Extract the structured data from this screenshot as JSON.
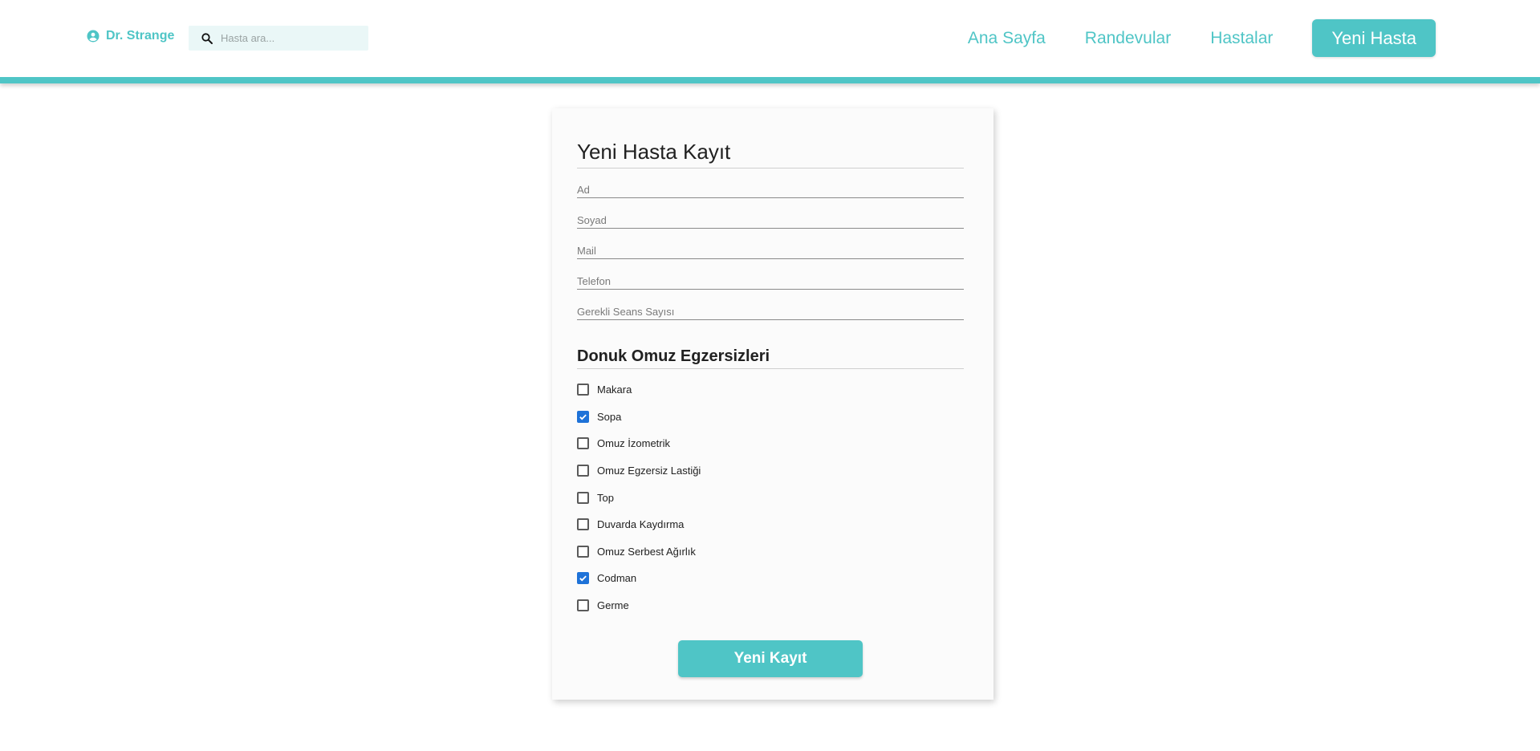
{
  "colors": {
    "accent": "#4fc5c6",
    "checkbox_checked": "#1e72d8",
    "search_bg": "#eaf7f7"
  },
  "header": {
    "user_name": "Dr. Strange",
    "user_icon": "account-circle-icon",
    "search_icon": "search-icon",
    "search_placeholder": "Hasta ara...",
    "search_value": "",
    "nav": {
      "home": "Ana Sayfa",
      "appointments": "Randevular",
      "patients": "Hastalar",
      "new_patient": "Yeni Hasta"
    }
  },
  "form": {
    "title": "Yeni Hasta Kayıt",
    "fields": {
      "first_name": {
        "placeholder": "Ad",
        "value": ""
      },
      "last_name": {
        "placeholder": "Soyad",
        "value": ""
      },
      "mail": {
        "placeholder": "Mail",
        "value": ""
      },
      "phone": {
        "placeholder": "Telefon",
        "value": ""
      },
      "sessions": {
        "placeholder": "Gerekli Seans Sayısı",
        "value": ""
      }
    },
    "exercises_title": "Donuk Omuz Egzersizleri",
    "exercises": [
      {
        "label": "Makara",
        "checked": false
      },
      {
        "label": "Sopa",
        "checked": true
      },
      {
        "label": "Omuz İzometrik",
        "checked": false
      },
      {
        "label": "Omuz Egzersiz Lastiği",
        "checked": false
      },
      {
        "label": "Top",
        "checked": false
      },
      {
        "label": "Duvarda Kaydırma",
        "checked": false
      },
      {
        "label": "Omuz Serbest Ağırlık",
        "checked": false
      },
      {
        "label": "Codman",
        "checked": true
      },
      {
        "label": "Germe",
        "checked": false
      }
    ],
    "submit_label": "Yeni Kayıt"
  }
}
